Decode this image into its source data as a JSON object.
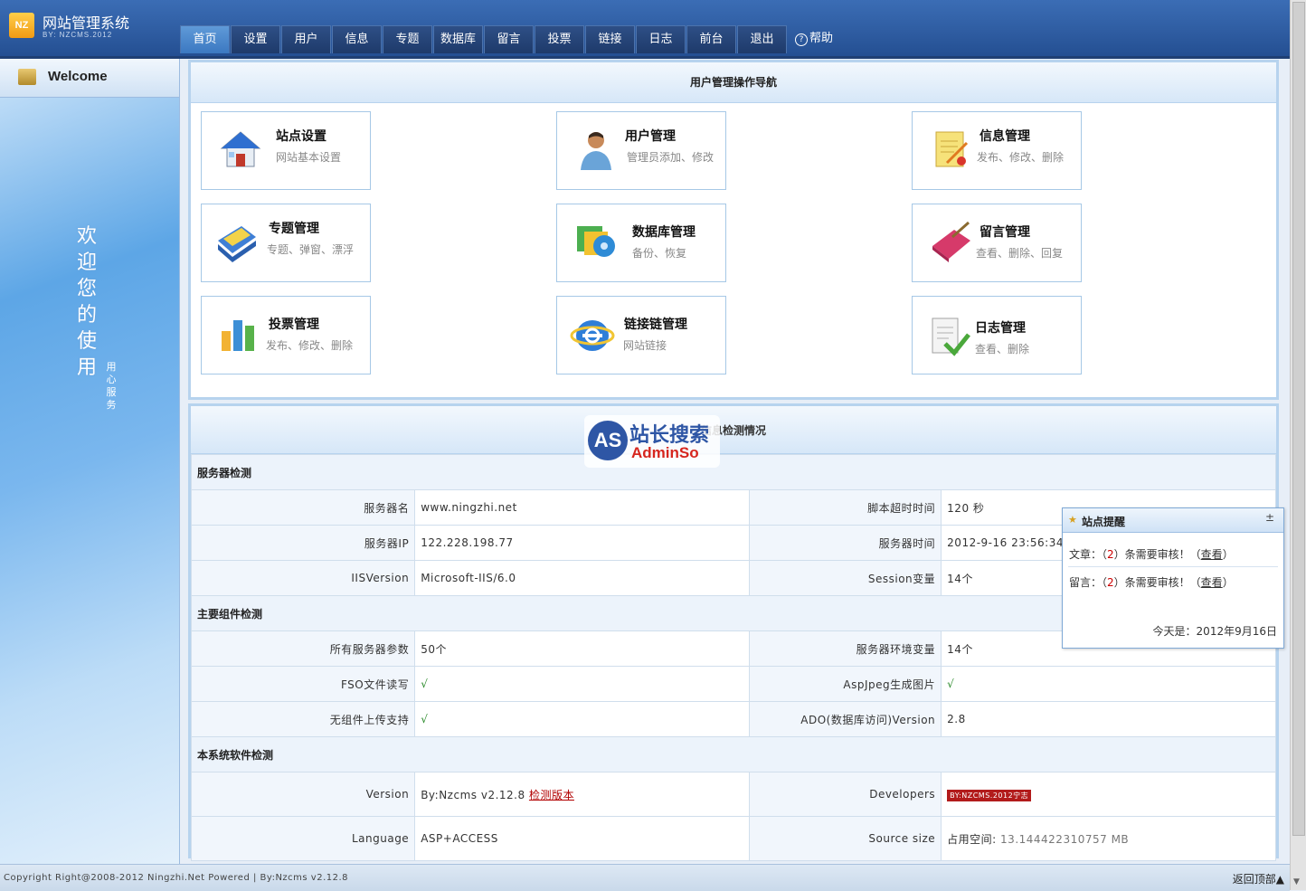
{
  "header": {
    "logo_badge": "NZ",
    "title": "网站管理系统",
    "subtitle": "BY: NZCMS.2012",
    "nav": [
      "首页",
      "设置",
      "用户",
      "信息",
      "专题",
      "数据库",
      "留言",
      "投票",
      "链接",
      "日志",
      "前台",
      "退出"
    ],
    "active_index": 0,
    "help_icon": "?",
    "help_label": "帮助"
  },
  "sidebar": {
    "welcome_label": "Welcome",
    "big_text": "欢迎您的使用",
    "small_text": "用心服务"
  },
  "nav_panel": {
    "title": "用户管理操作导航",
    "cards": [
      {
        "title": "站点设置",
        "desc": "网站基本设置",
        "icon": "house-icon"
      },
      {
        "title": "用户管理",
        "desc": "管理员添加、修改",
        "icon": "user-icon"
      },
      {
        "title": "信息管理",
        "desc": "发布、修改、删除",
        "icon": "document-edit-icon"
      },
      {
        "title": "专题管理",
        "desc": "专题、弹窗、漂浮",
        "icon": "folder-icon"
      },
      {
        "title": "数据库管理",
        "desc": "备份、恢复",
        "icon": "database-icon"
      },
      {
        "title": "留言管理",
        "desc": "查看、删除、回复",
        "icon": "book-icon"
      },
      {
        "title": "投票管理",
        "desc": "发布、修改、删除",
        "icon": "bar-chart-icon"
      },
      {
        "title": "链接链管理",
        "desc": "网站链接",
        "icon": "ie-icon"
      },
      {
        "title": "日志管理",
        "desc": "查看、删除",
        "icon": "checklist-icon"
      }
    ]
  },
  "info_panel": {
    "title": "信息检测情况",
    "watermark": {
      "as": "AS",
      "cn": "站长搜索",
      "en": "AdminSo"
    },
    "sections": {
      "server": "服务器检测",
      "components": "主要组件检测",
      "software": "本系统软件检测"
    },
    "rows": {
      "r1": {
        "k1": "服务器名",
        "v1": "www.ningzhi.net",
        "k2": "脚本超时时间",
        "v2": "120 秒"
      },
      "r2": {
        "k1": "服务器IP",
        "v1": "122.228.198.77",
        "k2": "服务器时间",
        "v2": "2012-9-16 23:56:34"
      },
      "r3": {
        "k1": "IISVersion",
        "v1": "Microsoft-IIS/6.0",
        "k2": "Session变量",
        "v2": "14个"
      },
      "r4": {
        "k1": "所有服务器参数",
        "v1": "50个",
        "k2": "服务器环境变量",
        "v2": "14个"
      },
      "r5": {
        "k1": "FSO文件读写",
        "v1": "√",
        "k2": "AspJpeg生成图片",
        "v2": "√"
      },
      "r6": {
        "k1": "无组件上传支持",
        "v1": "√",
        "k2": "ADO(数据库访问)Version",
        "v2": "2.8"
      },
      "r7": {
        "k1": "Version",
        "v1": "By:Nzcms v2.12.8",
        "v1_link": "检测版本",
        "k2": "Developers",
        "v2_badge": "BY:NZCMS.2012宁志"
      },
      "r8": {
        "k1": "Language",
        "v1": "ASP+ACCESS",
        "k2": "Source size",
        "v2_label": "占用空间:",
        "v2": "13.144422310757 MB"
      }
    }
  },
  "popup": {
    "title": "站点提醒",
    "close": "±",
    "line1": {
      "prefix": "文章：（",
      "num": "2",
      "suffix": "）条需要审核！（",
      "view": "查看",
      "end": "）"
    },
    "line2": {
      "prefix": "留言：（",
      "num": "2",
      "suffix": "）条需要审核！（",
      "view": "查看",
      "end": "）"
    },
    "today": "今天是：2012年9月16日"
  },
  "footer": {
    "copyright": "Copyright Right@2008-2012 Ningzhi.Net Powered | By:Nzcms v2.12.8",
    "back_top": "返回顶部▲"
  },
  "colors": {
    "header": "#2f5da2",
    "active_tab": "#3b78c1",
    "panel_border": "#b7d3ee",
    "link": "#b20000"
  }
}
